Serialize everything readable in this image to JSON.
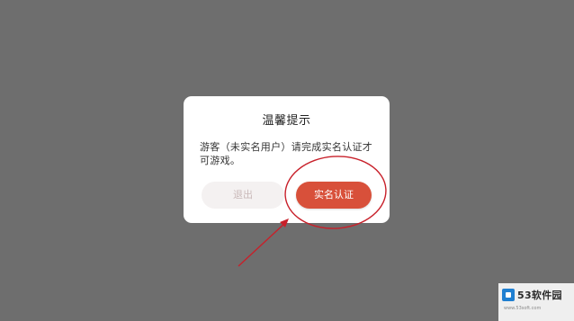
{
  "dialog": {
    "title": "温馨提示",
    "message": "游客（未实名用户）请完成实名认证才可游戏。",
    "exit_label": "退出",
    "verify_label": "实名认证"
  },
  "annotation": {
    "color": "#c8202a"
  },
  "watermark": {
    "brand": "53软件园",
    "url": "www.53soft.com"
  },
  "colors": {
    "backdrop": "#6e6e6e",
    "dialog_bg": "#ffffff",
    "primary_button": "#d8503a",
    "secondary_button": "#f4f1f1"
  }
}
